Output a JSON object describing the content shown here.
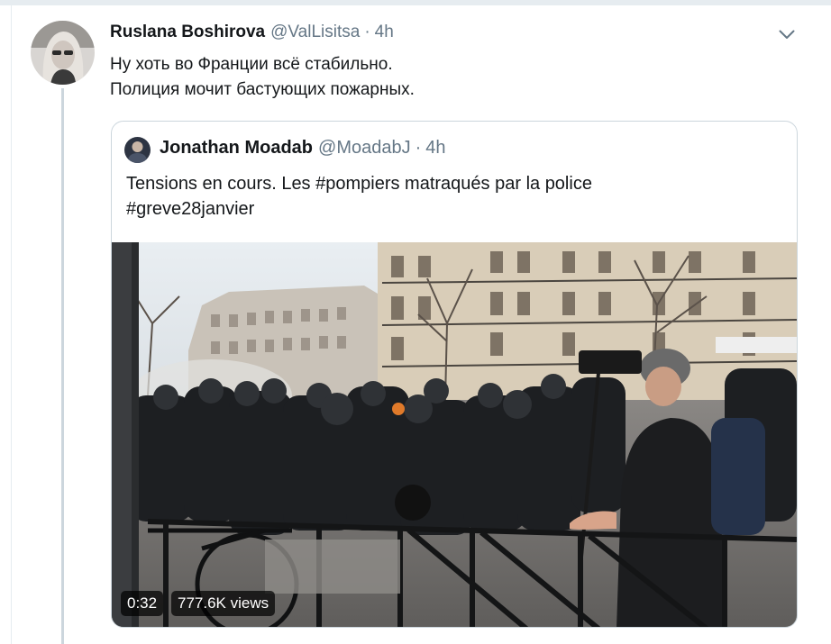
{
  "tweet": {
    "display_name": "Ruslana Boshirova",
    "handle": "@ValLisitsa",
    "separator": "·",
    "time": "4h",
    "text_lines": [
      "Ну хоть во Франции всё стабильно.",
      "Полиция мочит бастующих пожарных."
    ],
    "menu_icon": "chevron-down-icon"
  },
  "quote": {
    "display_name": "Jonathan Moadab",
    "handle": "@MoadabJ",
    "separator": "·",
    "time": "4h",
    "text_lines": [
      "Tensions en cours. Les #pompiers matraqués par la police",
      "#greve28janvier"
    ],
    "video": {
      "duration": "0:32",
      "views": "777.6K views"
    }
  },
  "colors": {
    "text": "#14171a",
    "secondary": "#657786",
    "border": "#ccd6dd",
    "background_strip": "#e6ecf0"
  }
}
